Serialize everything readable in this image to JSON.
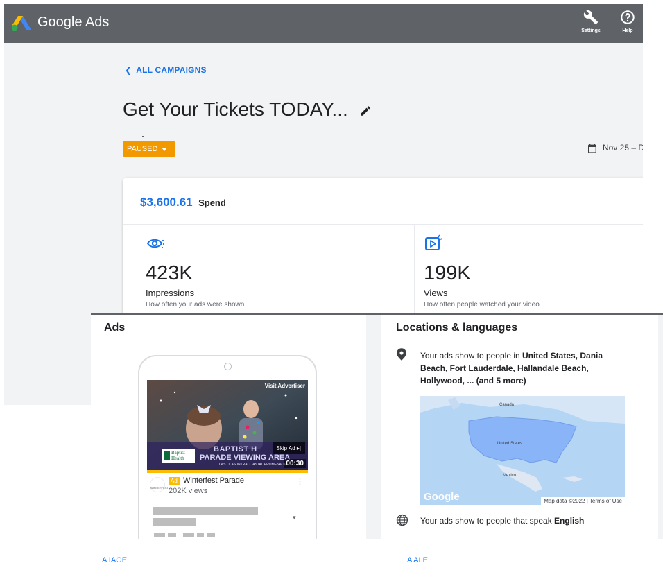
{
  "header": {
    "brand": "Google Ads",
    "settings_label": "Settings",
    "help_label": "Help"
  },
  "nav": {
    "back_label": "ALL CAMPAIGNS"
  },
  "campaign": {
    "title": "Get Your Tickets TODAY...",
    "status": "PAUSED",
    "date_range": "Nov 25 – D"
  },
  "summary": {
    "spend_value": "$3,600.61",
    "spend_label": "Spend",
    "impressions": {
      "value": "423K",
      "label": "Impressions",
      "description": "How often your ads were shown"
    },
    "views": {
      "value": "199K",
      "label": "Views",
      "description": "How often people watched your video"
    }
  },
  "ads_panel": {
    "title": "Ads",
    "video": {
      "visit_advertiser": "Visit Advertiser",
      "skip_ad": "Skip Ad ▸|",
      "duration": "00:30",
      "overlay_line1": "BAPTIST H",
      "overlay_line2": "PARADE VIEWING AREA",
      "overlay_line3": "LAS OLAS INTRACOASTAL PROMENADE",
      "logo_text_1": "Baptist",
      "logo_text_2": "Health"
    },
    "ad_badge": "Ad",
    "ad_title": "Winterfest Parade",
    "ad_views": "202K views",
    "channel_name": "WINTERFEST",
    "footer_label": "A  IAGE"
  },
  "locations_panel": {
    "title": "Locations & languages",
    "locations_prefix": "Your ads show to people in ",
    "locations_list": "United States, Dania Beach, Fort Lauderdale, Hallandale Beach, Hollywood, ... (and 5 more)",
    "map": {
      "label_canada": "Canada",
      "label_us": "United States",
      "label_mexico": "Mexico",
      "watermark": "Google",
      "attribution": "Map data ©2022  |  Terms of Use"
    },
    "languages_prefix": "Your ads show to people that speak ",
    "language": "English",
    "footer_label": "A  AI  E"
  },
  "colors": {
    "topbar": "#5f6368",
    "accent": "#1a73e8",
    "paused": "#f29900",
    "map_water": "#b5d5f5",
    "map_us": "#8ab4f8"
  },
  "icons": [
    "google-ads-logo",
    "wrench-icon",
    "help-icon",
    "chevron-left-icon",
    "pencil-icon",
    "caret-down-icon",
    "calendar-icon",
    "eye-icon",
    "video-icon",
    "location-pin-icon",
    "globe-icon",
    "more-vert-icon"
  ]
}
